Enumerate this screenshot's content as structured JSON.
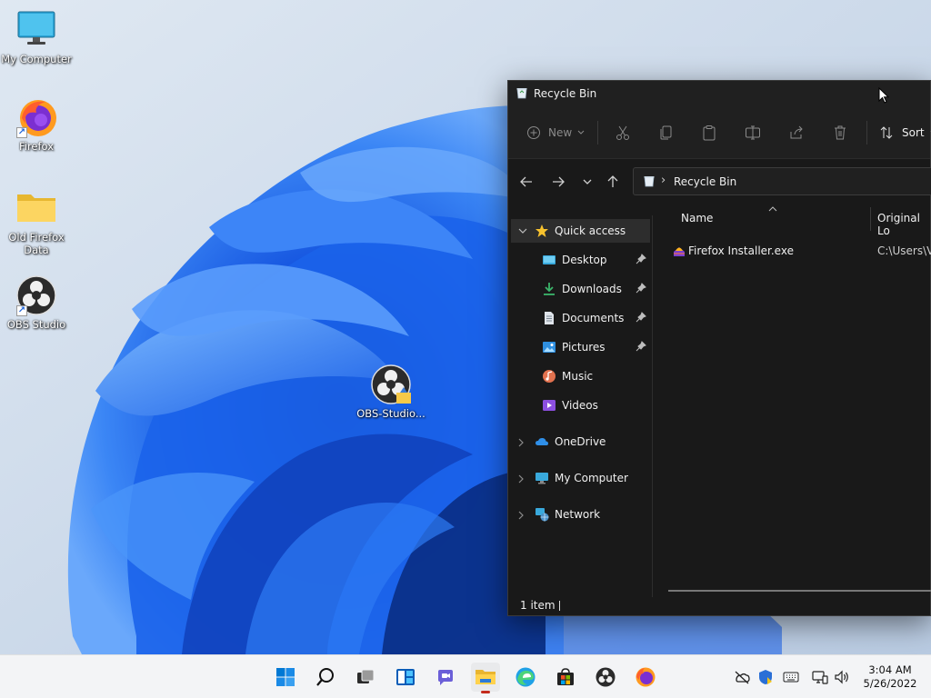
{
  "desktop": {
    "icons": [
      {
        "label": "My Computer",
        "icon": "monitor-icon"
      },
      {
        "label": "Firefox",
        "icon": "firefox-icon"
      },
      {
        "label": "Old Firefox Data",
        "icon": "folder-icon"
      },
      {
        "label": "OBS Studio",
        "icon": "obs-icon"
      },
      {
        "label": "OBS-Studio...",
        "icon": "obs-installer-icon"
      }
    ]
  },
  "explorer": {
    "title": "Recycle Bin",
    "toolbar": {
      "new_label": "New",
      "sort_label": "Sort"
    },
    "address": {
      "current": "Recycle Bin"
    },
    "nav": {
      "quick_access": "Quick access",
      "items": [
        "Desktop",
        "Downloads",
        "Documents",
        "Pictures",
        "Music",
        "Videos"
      ],
      "onedrive": "OneDrive",
      "my_computer": "My Computer",
      "network": "Network"
    },
    "columns": {
      "name": "Name",
      "original_location": "Original Lo"
    },
    "files": [
      {
        "name": "Firefox Installer.exe",
        "original_location": "C:\\Users\\V"
      }
    ],
    "status": "1 item"
  },
  "taskbar": {
    "time": "3:04 AM",
    "date": "5/26/2022"
  },
  "colors": {
    "accent": "#0067c0",
    "explorer_bg": "#191919",
    "taskbar_bg": "#f3f4f6",
    "running_indicator": "#c42b1c"
  }
}
